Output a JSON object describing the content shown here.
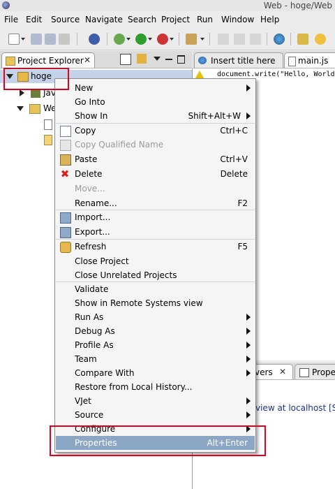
{
  "window": {
    "title": "Web - hoge/Web"
  },
  "menubar": {
    "items": [
      "File",
      "Edit",
      "Source",
      "Navigate",
      "Search",
      "Project",
      "Run",
      "Window",
      "Help"
    ]
  },
  "project_explorer": {
    "tab_label": "Project Explorer",
    "close": "✕",
    "tree": [
      {
        "label": "hoge",
        "selected": true
      },
      {
        "label": "Jav"
      },
      {
        "label": "We"
      }
    ]
  },
  "editor": {
    "tabs": [
      {
        "label": "Insert title here"
      },
      {
        "label": "main.js",
        "active": true
      }
    ],
    "code": "document.write(\"Hello, World!\");"
  },
  "bottom_panel": {
    "tabs": [
      {
        "label": "vers",
        "close": "✕"
      },
      {
        "label": "Prope"
      }
    ],
    "server_row": "view at localhost  [Sta"
  },
  "context_menu": {
    "items": [
      {
        "label": "New",
        "submenu": true
      },
      {
        "label": "Go Into"
      },
      {
        "label": "Show In",
        "shortcut": "Shift+Alt+W",
        "submenu": true
      },
      {
        "label": "Copy",
        "shortcut": "Ctrl+C",
        "icon": "copy-icon"
      },
      {
        "label": "Copy Qualified Name",
        "disabled": true,
        "icon": "copy-qualified-name-icon"
      },
      {
        "label": "Paste",
        "shortcut": "Ctrl+V",
        "icon": "paste-icon"
      },
      {
        "label": "Delete",
        "shortcut": "Delete",
        "icon": "delete-icon"
      },
      {
        "label": "Move...",
        "disabled": true
      },
      {
        "label": "Rename...",
        "shortcut": "F2"
      },
      {
        "label": "Import...",
        "icon": "import-icon"
      },
      {
        "label": "Export...",
        "icon": "export-icon"
      },
      {
        "label": "Refresh",
        "shortcut": "F5",
        "icon": "refresh-icon"
      },
      {
        "label": "Close Project"
      },
      {
        "label": "Close Unrelated Projects"
      },
      {
        "label": "Validate"
      },
      {
        "label": "Show in Remote Systems view"
      },
      {
        "label": "Run As",
        "submenu": true
      },
      {
        "label": "Debug As",
        "submenu": true
      },
      {
        "label": "Profile As",
        "submenu": true
      },
      {
        "label": "Team",
        "submenu": true
      },
      {
        "label": "Compare With",
        "submenu": true
      },
      {
        "label": "Restore from Local History..."
      },
      {
        "label": "VJet",
        "submenu": true
      },
      {
        "label": "Source",
        "submenu": true
      },
      {
        "label": "Configure",
        "submenu": true
      },
      {
        "label": "Properties",
        "shortcut": "Alt+Enter",
        "active": true
      }
    ]
  },
  "colors": {
    "selection": "#c3d3ea",
    "menu_active": "#8ca7c6",
    "highlight_box": "#e2001a",
    "delete_red": "#d42020",
    "warning_yellow": "#e8c200"
  }
}
